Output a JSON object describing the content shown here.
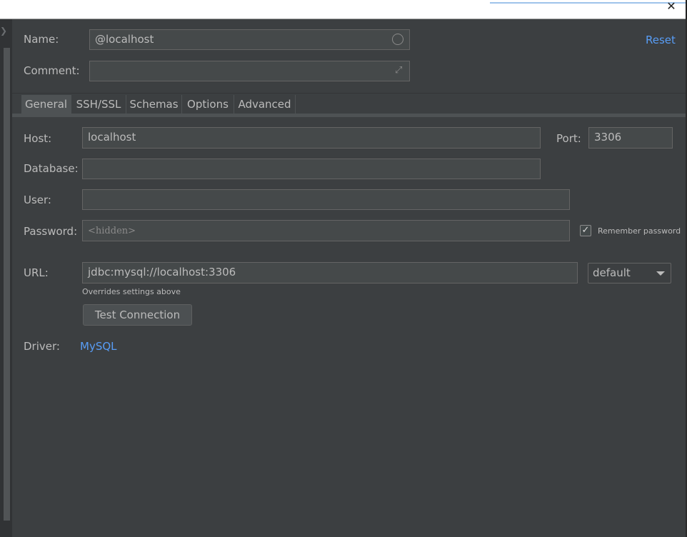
{
  "window": {
    "close_glyph": "✕"
  },
  "header": {
    "name_label": "Name:",
    "name_value": "@localhost",
    "comment_label": "Comment:",
    "comment_value": "",
    "reset_label": "Reset"
  },
  "tabs": [
    {
      "label": "General",
      "active": true
    },
    {
      "label": "SSH/SSL",
      "active": false
    },
    {
      "label": "Schemas",
      "active": false
    },
    {
      "label": "Options",
      "active": false
    },
    {
      "label": "Advanced",
      "active": false
    }
  ],
  "general": {
    "host_label": "Host:",
    "host_value": "localhost",
    "port_label": "Port:",
    "port_value": "3306",
    "database_label": "Database:",
    "database_value": "",
    "user_label": "User:",
    "user_value": "",
    "password_label": "Password:",
    "password_placeholder": "<hidden>",
    "remember_password_label": "Remember password",
    "remember_password_checked": true,
    "url_label": "URL:",
    "url_value": "jdbc:mysql://localhost:3306",
    "url_mode": "default",
    "url_hint": "Overrides settings above",
    "test_connection_label": "Test Connection",
    "driver_label": "Driver:",
    "driver_value": "MySQL"
  },
  "colors": {
    "background": "#3c3f41",
    "field": "#45494a",
    "link": "#589df6",
    "text": "#bbbbbb"
  }
}
